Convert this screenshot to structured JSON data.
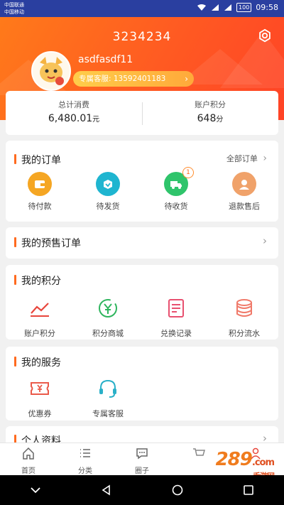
{
  "status_bar": {
    "carrier_1": "中国联通",
    "carrier_2": "中国移动",
    "battery": "100",
    "time": "09:58"
  },
  "header": {
    "title": "3234234",
    "username": "asdfasdf11",
    "service_label": "专属客服: 13592401183",
    "icons": [
      "settings-gear-icon",
      "avatar-mascot"
    ]
  },
  "stats": [
    {
      "label": "总计消费",
      "value": "6,480.01",
      "unit": "元"
    },
    {
      "label": "账户积分",
      "value": "648",
      "unit": "分"
    }
  ],
  "orders": {
    "title": "我的订单",
    "all_label": "全部订单",
    "items": [
      {
        "label": "待付款",
        "icon": "wallet-icon",
        "color": "#f5a623"
      },
      {
        "label": "待发货",
        "icon": "package-icon",
        "color": "#1fb5d0"
      },
      {
        "label": "待收货",
        "icon": "delivery-truck-icon",
        "color": "#2fc46b",
        "badge": "1"
      },
      {
        "label": "退款售后",
        "icon": "service-agent-icon",
        "color": "#f0a26a"
      }
    ]
  },
  "presale": {
    "title": "我的预售订单"
  },
  "points": {
    "title": "我的积分",
    "items": [
      {
        "label": "账户积分",
        "icon": "trend-chart-icon"
      },
      {
        "label": "积分商城",
        "icon": "yen-circle-icon"
      },
      {
        "label": "兑换记录",
        "icon": "receipt-icon"
      },
      {
        "label": "积分流水",
        "icon": "coin-stack-icon"
      }
    ]
  },
  "services": {
    "title": "我的服务",
    "items": [
      {
        "label": "优惠券",
        "icon": "coupon-icon"
      },
      {
        "label": "专属客服",
        "icon": "headset-icon"
      }
    ]
  },
  "next_section": {
    "title": "个人资料"
  },
  "tabbar": [
    {
      "label": "首页",
      "icon": "home-icon"
    },
    {
      "label": "分类",
      "icon": "list-icon"
    },
    {
      "label": "圈子",
      "icon": "chat-bubble-icon"
    },
    {
      "label": "",
      "icon": "cart-icon"
    },
    {
      "label": "",
      "icon": "user-icon"
    }
  ],
  "watermark": {
    "text": "289",
    "suffix": ".com",
    "sub": "手游网"
  },
  "colors": {
    "brand_orange": "#ff5a22",
    "status_bar": "#2a3fa0",
    "accent": "#ff6a1f"
  }
}
